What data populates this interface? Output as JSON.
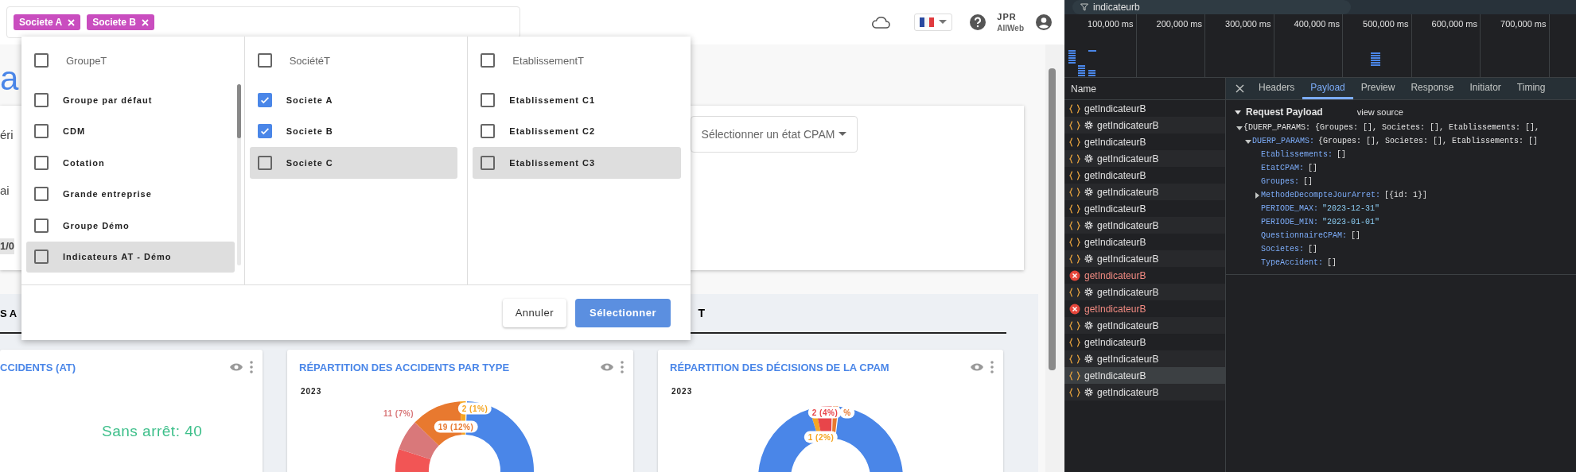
{
  "top_bar": {
    "tags": [
      {
        "label": "Societe A"
      },
      {
        "label": "Societe B"
      }
    ],
    "user": {
      "initials": "JPR",
      "company": "AllWeb"
    }
  },
  "page": {
    "title": "a",
    "filter_card": {
      "fragments": [
        {
          "text": "éri",
          "kind": "label"
        },
        {
          "text": "ai",
          "kind": "label"
        },
        {
          "text": "1/0",
          "kind": "chip"
        }
      ],
      "cpam_select": {
        "label": "Sélectionner un état CPAM"
      }
    },
    "tab_strip": {
      "tabs": [
        {
          "label": "S A"
        },
        {
          "label": "T"
        }
      ]
    },
    "cards": [
      {
        "kind": "stat",
        "title": "CCIDENTS (AT)",
        "stat": "Sans arrêt: 40"
      },
      {
        "kind": "donut",
        "title": "RÉPARTITION DES ACCIDENTS PAR TYPE",
        "year": "2023",
        "labels": [
          {
            "text": "2 (1%)",
            "color": "#f5a623"
          },
          {
            "text": "19 (12%)",
            "color": "#e8792f"
          },
          {
            "text": "11 (7%)",
            "color": "#d9787a"
          }
        ]
      },
      {
        "kind": "donut",
        "title": "RÉPARTITION DES DÉCISIONS DE LA CPAM",
        "year": "2023",
        "labels": [
          {
            "text": "%",
            "color": "#e8792f"
          },
          {
            "text": "2 (4%)",
            "color": "#e8454a"
          },
          {
            "text": "1 (2%)",
            "color": "#f5a623"
          }
        ]
      }
    ]
  },
  "selector": {
    "columns": [
      {
        "header": "GroupeT",
        "checked": false,
        "items": [
          {
            "label": "Groupe par défaut",
            "checked": false,
            "highlighted": false
          },
          {
            "label": "CDM",
            "checked": false,
            "highlighted": false
          },
          {
            "label": "Cotation",
            "checked": false,
            "highlighted": false
          },
          {
            "label": "Grande entreprise",
            "checked": false,
            "highlighted": false
          },
          {
            "label": "Groupe Démo",
            "checked": false,
            "highlighted": false
          },
          {
            "label": "Indicateurs AT - Démo",
            "checked": false,
            "highlighted": true
          }
        ]
      },
      {
        "header": "SociétéT",
        "checked": false,
        "items": [
          {
            "label": "Societe A",
            "checked": true,
            "highlighted": false
          },
          {
            "label": "Societe B",
            "checked": true,
            "highlighted": false
          },
          {
            "label": "Societe C",
            "checked": false,
            "highlighted": true
          }
        ]
      },
      {
        "header": "EtablissementT",
        "checked": false,
        "items": [
          {
            "label": "Etablissement C1",
            "checked": false,
            "highlighted": false
          },
          {
            "label": "Etablissement C2",
            "checked": false,
            "highlighted": false
          },
          {
            "label": "Etablissement C3",
            "checked": false,
            "highlighted": true
          }
        ]
      }
    ],
    "buttons": [
      {
        "label": "Annuler",
        "kind": "secondary"
      },
      {
        "label": "Sélectionner",
        "kind": "primary"
      }
    ]
  },
  "devtools": {
    "filter": {
      "value": "indicateurb"
    },
    "timeline": {
      "ticks": [
        "100,000 ms",
        "200,000 ms",
        "300,000 ms",
        "400,000 ms",
        "500,000 ms",
        "600,000 ms",
        "700,000 ms"
      ]
    },
    "requests": {
      "header": "Name",
      "rows": [
        {
          "name": "getIndicateurB",
          "kind": "fetch",
          "selected": false
        },
        {
          "name": "getIndicateurB",
          "kind": "gear",
          "selected": false
        },
        {
          "name": "getIndicateurB",
          "kind": "fetch",
          "selected": false
        },
        {
          "name": "getIndicateurB",
          "kind": "gear",
          "selected": false
        },
        {
          "name": "getIndicateurB",
          "kind": "fetch",
          "selected": false
        },
        {
          "name": "getIndicateurB",
          "kind": "gear",
          "selected": false
        },
        {
          "name": "getIndicateurB",
          "kind": "fetch",
          "selected": false
        },
        {
          "name": "getIndicateurB",
          "kind": "gear",
          "selected": false
        },
        {
          "name": "getIndicateurB",
          "kind": "fetch",
          "selected": false
        },
        {
          "name": "getIndicateurB",
          "kind": "gear",
          "selected": false
        },
        {
          "name": "getIndicateurB",
          "kind": "error",
          "selected": false
        },
        {
          "name": "getIndicateurB",
          "kind": "gear",
          "selected": false
        },
        {
          "name": "getIndicateurB",
          "kind": "error",
          "selected": false
        },
        {
          "name": "getIndicateurB",
          "kind": "gear",
          "selected": false
        },
        {
          "name": "getIndicateurB",
          "kind": "fetch",
          "selected": false
        },
        {
          "name": "getIndicateurB",
          "kind": "gear",
          "selected": false
        },
        {
          "name": "getIndicateurB",
          "kind": "fetch",
          "selected": true
        },
        {
          "name": "getIndicateurB",
          "kind": "gear",
          "selected": false
        }
      ]
    },
    "tabs": [
      {
        "label": "Headers",
        "selected": false
      },
      {
        "label": "Payload",
        "selected": true
      },
      {
        "label": "Preview",
        "selected": false
      },
      {
        "label": "Response",
        "selected": false
      },
      {
        "label": "Initiator",
        "selected": false
      },
      {
        "label": "Timing",
        "selected": false
      }
    ],
    "payload": {
      "title": "Request Payload",
      "expanded": true,
      "view_source": "view source",
      "tree": [
        {
          "value": "{DUERP_PARAMS: {Groupes: [], Societes: [], Etablissements: [],",
          "expanded": true,
          "children": [
            {
              "key": "DUERP_PARAMS:",
              "value": "{Groupes: [], Societes: [], Etablissements: []",
              "expanded": true,
              "children": [
                {
                  "key": "Etablissements:",
                  "value": "[]"
                },
                {
                  "key": "EtatCPAM:",
                  "value": "[]"
                },
                {
                  "key": "Groupes:",
                  "value": "[]"
                },
                {
                  "key": "MethodeDecompteJourArret:",
                  "value": "[{id: 1}]",
                  "expanded": false
                },
                {
                  "key": "PERIODE_MAX:",
                  "value": "\"2023-12-31\"",
                  "kind": "string"
                },
                {
                  "key": "PERIODE_MIN:",
                  "value": "\"2023-01-01\"",
                  "kind": "string"
                },
                {
                  "key": "QuestionnaireCPAM:",
                  "value": "[]"
                },
                {
                  "key": "Societes:",
                  "value": "[]"
                },
                {
                  "key": "TypeAccident:",
                  "value": "[]"
                }
              ]
            }
          ]
        }
      ]
    }
  }
}
